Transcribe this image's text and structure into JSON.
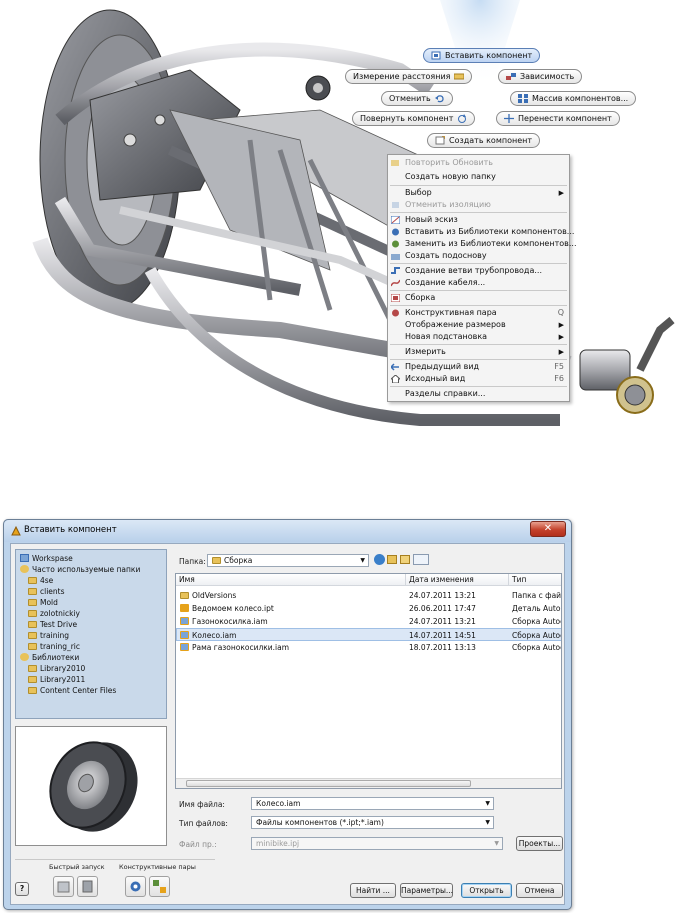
{
  "marking_menu": {
    "place_component": "Вставить компонент",
    "measure_distance": "Измерение расстояния",
    "constraint": "Зависимость",
    "undo": "Отменить",
    "pattern_components": "Массив компонентов...",
    "rotate_component": "Повернуть компонент",
    "move_component": "Перенести компонент",
    "create_component": "Создать компонент"
  },
  "context_menu": {
    "items": [
      {
        "label": "Повторить Обновить",
        "disabled": true
      },
      {
        "label": "Создать новую папку"
      },
      {
        "label": "Выбор",
        "submenu": true
      },
      {
        "label": "Отменить изоляцию",
        "disabled": true
      },
      {
        "label": "Новый эскиз"
      },
      {
        "label": "Вставить из Библиотеки компонентов..."
      },
      {
        "label": "Заменить из Библиотеки компонентов..."
      },
      {
        "label": "Создать подоснову"
      },
      {
        "label": "Создание ветви трубопровода..."
      },
      {
        "label": "Создание кабеля..."
      },
      {
        "label": "Сборка"
      },
      {
        "label": "Конструктивная пара",
        "shortcut": "Q"
      },
      {
        "label": "Отображение размеров",
        "submenu": true
      },
      {
        "label": "Новая подстановка",
        "submenu": true
      },
      {
        "label": "Измерить",
        "submenu": true
      },
      {
        "label": "Предыдущий вид",
        "shortcut": "F5"
      },
      {
        "label": "Исходный вид",
        "shortcut": "F6"
      },
      {
        "label": "Разделы справки..."
      }
    ]
  },
  "dialog": {
    "title": "Вставить компонент",
    "close_glyph": "✕",
    "places": {
      "workspace": "Workspase",
      "frequent": "Часто используемые папки",
      "frequent_items": [
        "4se",
        "clients",
        "Mold",
        "zolotnickiy",
        "Test Drive",
        "training",
        "traning_ric"
      ],
      "libraries": "Библиотеки",
      "library_items": [
        "Library2010",
        "Library2011",
        "Content Center Files"
      ]
    },
    "folder_label": "Папка:",
    "folder_value": "Сборка",
    "columns": {
      "name": "Имя",
      "date": "Дата изменения",
      "type": "Тип"
    },
    "files": [
      {
        "name": "OldVersions",
        "date": "24.07.2011 13:21",
        "type": "Папка с фай",
        "icon": "folder"
      },
      {
        "name": "Ведомоем колесо.ipt",
        "date": "26.06.2011 17:47",
        "type": "Деталь Autod",
        "icon": "part"
      },
      {
        "name": "Газонокосилка.iam",
        "date": "24.07.2011 13:21",
        "type": "Сборка Autoc",
        "icon": "assembly"
      },
      {
        "name": "Колесо.iam",
        "date": "14.07.2011 14:51",
        "type": "Сборка Autoc",
        "icon": "assembly",
        "selected": true
      },
      {
        "name": "Рама газонокосилки.iam",
        "date": "18.07.2011 13:13",
        "type": "Сборка Autoc",
        "icon": "assembly"
      }
    ],
    "filename_label": "Имя файла:",
    "filename_value": "Колесо.iam",
    "filetype_label": "Тип файлов:",
    "filetype_value": "Файлы компонентов (*.ipt;*.iam)",
    "project_label": "Файл пр.:",
    "project_value": "minibike.ipj",
    "projects_button": "Проекты...",
    "quick_launch": "Быстрый запуск",
    "constraint_pairs": "Конструктивные пары",
    "find_button": "Найти ...",
    "options_button": "Параметры...",
    "open_button": "Открыть",
    "cancel_button": "Отмена",
    "help_glyph": "?"
  }
}
